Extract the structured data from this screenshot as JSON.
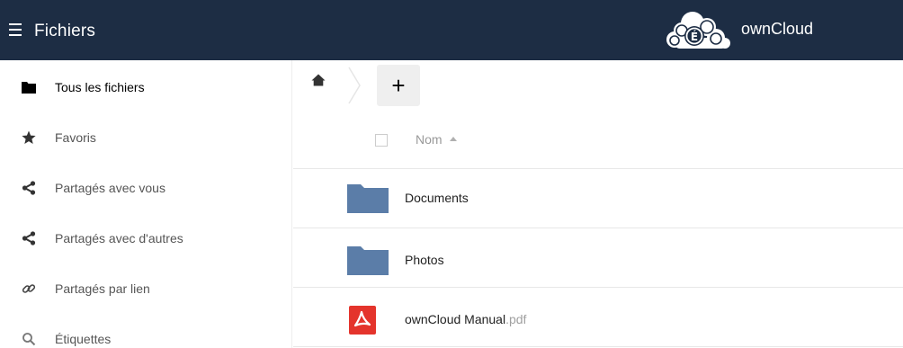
{
  "header": {
    "app_title": "Fichiers",
    "brand_name": "ownCloud",
    "menu_icon": "hamburger-icon",
    "logo_icon": "cloud-logo-icon",
    "background": "#1d2d44"
  },
  "sidebar": {
    "items": [
      {
        "label": "Tous les fichiers",
        "icon": "folder-icon",
        "active": true
      },
      {
        "label": "Favoris",
        "icon": "star-icon"
      },
      {
        "label": "Partagés avec vous",
        "icon": "share-icon"
      },
      {
        "label": "Partagés avec d'autres",
        "icon": "share-icon"
      },
      {
        "label": "Partagés par lien",
        "icon": "link-icon"
      },
      {
        "label": "Étiquettes",
        "icon": "search-icon"
      }
    ]
  },
  "controls": {
    "home_icon": "home-icon",
    "new_button_label": "+"
  },
  "table": {
    "name_header": "Nom",
    "sort": "ascending",
    "files": [
      {
        "name": "Documents",
        "ext": "",
        "type": "folder",
        "icon": "folder-icon",
        "color": "#5b7da8"
      },
      {
        "name": "Photos",
        "ext": "",
        "type": "folder",
        "icon": "folder-icon",
        "color": "#5b7da8"
      },
      {
        "name": "ownCloud Manual",
        "ext": ".pdf",
        "type": "pdf",
        "icon": "pdf-icon",
        "color": "#e4342c"
      }
    ]
  }
}
